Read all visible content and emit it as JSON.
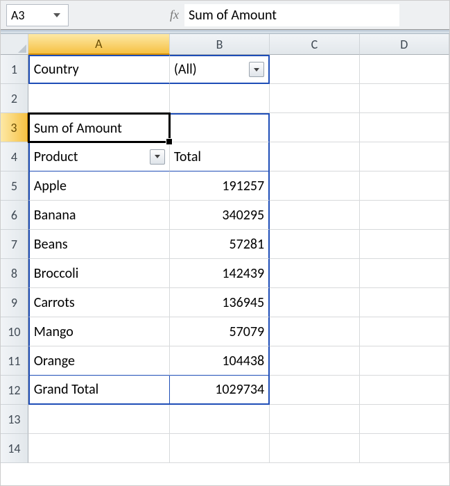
{
  "formula_bar": {
    "name_box": "A3",
    "fx_label": "fx",
    "content": "Sum of Amount"
  },
  "columns": [
    "A",
    "B",
    "C",
    "D"
  ],
  "rows": [
    "1",
    "2",
    "3",
    "4",
    "5",
    "6",
    "7",
    "8",
    "9",
    "10",
    "11",
    "12",
    "13",
    "14"
  ],
  "cells": {
    "A1": "Country",
    "B1": "(All)",
    "A3": "Sum of Amount",
    "A4": "Product",
    "B4": "Total",
    "A5": "Apple",
    "B5": "191257",
    "A6": "Banana",
    "B6": "340295",
    "A7": "Beans",
    "B7": "57281",
    "A8": "Broccoli",
    "B8": "142439",
    "A9": "Carrots",
    "B9": "136945",
    "A10": "Mango",
    "B10": "57079",
    "A11": "Orange",
    "B11": "104438",
    "A12": "Grand Total",
    "B12": "1029734"
  },
  "chart_data": {
    "type": "table",
    "title": "Sum of Amount",
    "filter": {
      "field": "Country",
      "value": "(All)"
    },
    "columns": [
      "Product",
      "Total"
    ],
    "rows": [
      {
        "Product": "Apple",
        "Total": 191257
      },
      {
        "Product": "Banana",
        "Total": 340295
      },
      {
        "Product": "Beans",
        "Total": 57281
      },
      {
        "Product": "Broccoli",
        "Total": 142439
      },
      {
        "Product": "Carrots",
        "Total": 136945
      },
      {
        "Product": "Mango",
        "Total": 57079
      },
      {
        "Product": "Orange",
        "Total": 104438
      }
    ],
    "grand_total": 1029734
  }
}
